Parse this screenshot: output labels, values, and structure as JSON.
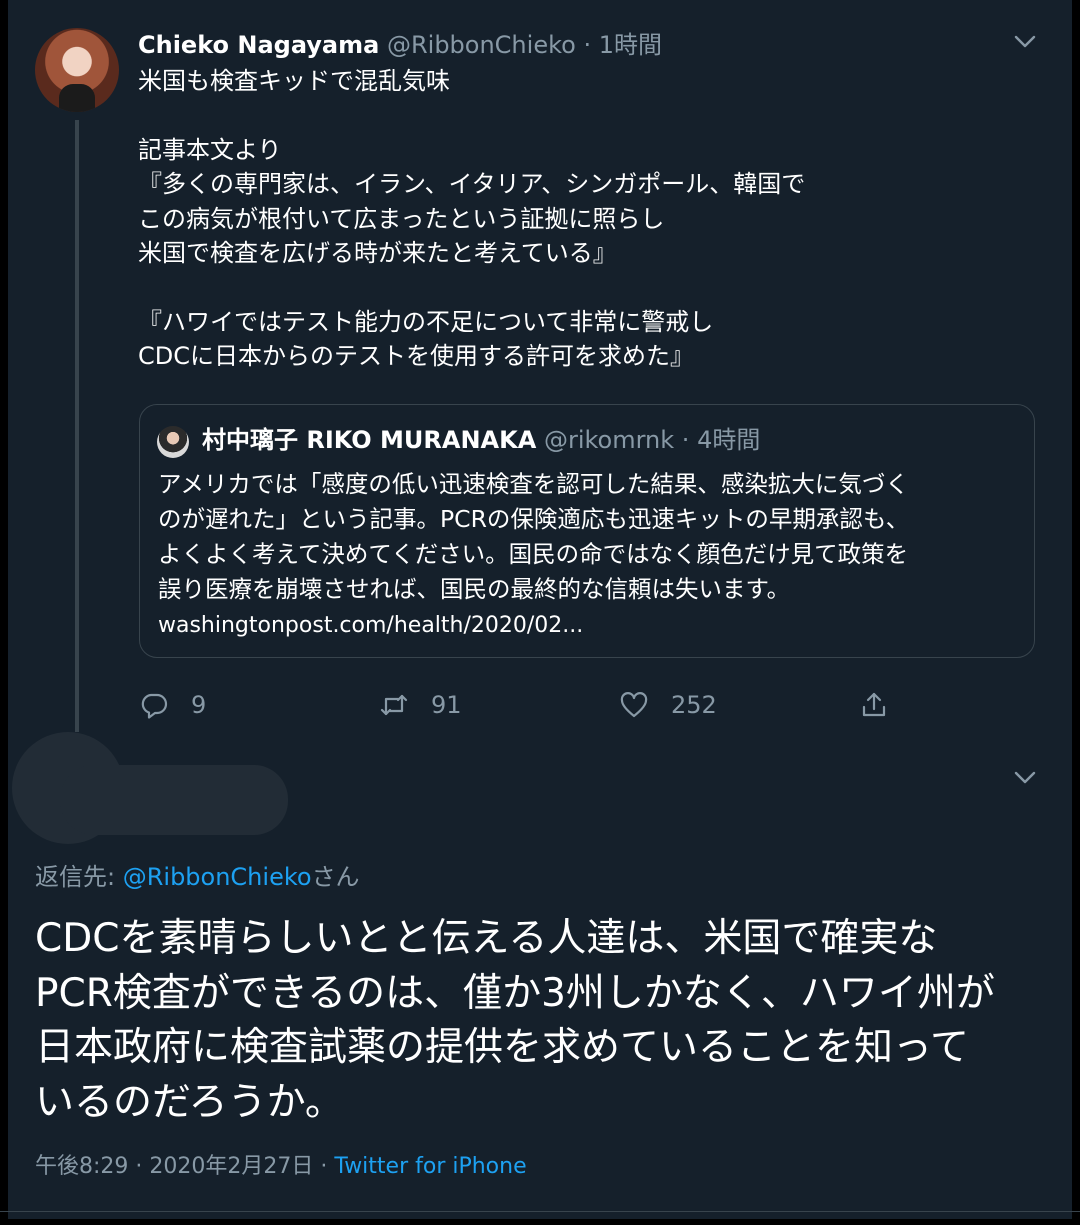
{
  "tweet": {
    "author": {
      "name": "Chieko Nagayama",
      "handle": "@RibbonChieko"
    },
    "separator": "·",
    "time_ago": "1時間",
    "text": "米国も検査キッドで混乱気味\n\n記事本文より\n『多くの専門家は、イラン、イタリア、シンガポール、韓国で\nこの病気が根付いて広まったという証拠に照らし\n米国で検査を広げる時が来たと考えている』\n\n『ハワイではテスト能力の不足について非常に警戒し\nCDCに日本からのテストを使用する許可を求めた』",
    "quote": {
      "name": "村中璃子 RIKO MURANAKA",
      "handle": "@rikomrnk",
      "separator": "·",
      "time_ago": "4時間",
      "text": "アメリカでは「感度の低い迅速検査を認可した結果、感染拡大に気づく\nのが遅れた」という記事。PCRの保険適応も迅速キットの早期承認も、\nよくよく考えて決めてください。国民の命ではなく顔色だけ見て政策を\n誤り医療を崩壊させれば、国民の最終的な信頼は失います。",
      "link": "washingtonpost.com/health/2020/02..."
    },
    "actions": {
      "replies": "9",
      "retweets": "91",
      "likes": "252"
    }
  },
  "reply": {
    "reply_to_label": "返信先: ",
    "reply_to_mention": "@RibbonChieko",
    "reply_to_suffix": "さん",
    "text": "CDCを素晴らしいとと伝える人達は、米国で確実な\nPCR検査ができるのは、僅か3州しかなく、ハワイ州が\n日本政府に検査試薬の提供を求めていることを知って\nいるのだろうか。",
    "time": "午後8:29",
    "separator": "·",
    "date": "2020年2月27日",
    "source": "Twitter for iPhone"
  },
  "colors": {
    "background": "#15202b",
    "secondary_text": "#8899a6",
    "accent_blue": "#1da1f2",
    "border": "#38444d"
  },
  "icons": [
    "chevron-down-icon",
    "reply-icon",
    "retweet-icon",
    "like-icon",
    "share-icon"
  ]
}
